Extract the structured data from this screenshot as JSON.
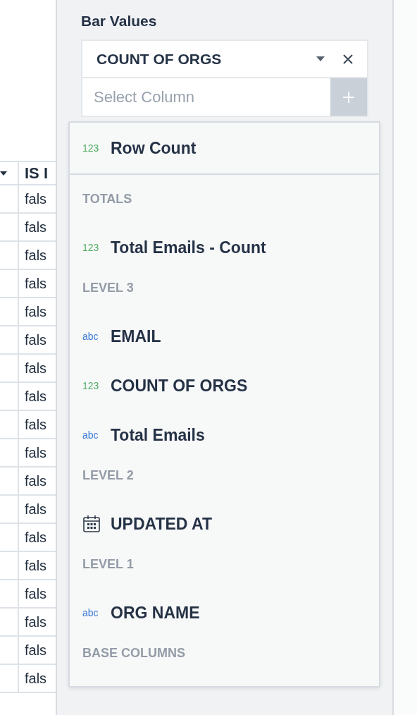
{
  "table": {
    "column_heading": "IS I",
    "rows": [
      "fals",
      "fals",
      "fals",
      "fals",
      "fals",
      "fals",
      "fals",
      "fals",
      "fals",
      "fals",
      "fals",
      "fals",
      "fals",
      "fals",
      "fals",
      "fals",
      "fals",
      "fals"
    ]
  },
  "panel": {
    "section_label": "Bar Values",
    "selected_value": "COUNT OF ORGS",
    "add_field": {
      "placeholder": "Select Column"
    }
  },
  "dropdown": {
    "top_item": {
      "type_label": "123",
      "color": "#4fae62",
      "label": "Row Count"
    },
    "items": [
      {
        "kind": "header",
        "label": "TOTALS"
      },
      {
        "kind": "item",
        "type_label": "123",
        "color": "#4fae62",
        "label": "Total Emails - Count"
      },
      {
        "kind": "header",
        "label": "LEVEL 3"
      },
      {
        "kind": "item",
        "type_label": "abc",
        "color": "#3a7bd5",
        "label": "EMAIL"
      },
      {
        "kind": "item",
        "type_label": "123",
        "color": "#4fae62",
        "label": "COUNT OF ORGS"
      },
      {
        "kind": "item",
        "type_label": "abc",
        "color": "#3a7bd5",
        "label": "Total Emails"
      },
      {
        "kind": "header",
        "label": "LEVEL 2"
      },
      {
        "kind": "date_item",
        "label": "UPDATED AT"
      },
      {
        "kind": "header",
        "label": "LEVEL 1"
      },
      {
        "kind": "item",
        "type_label": "abc",
        "color": "#3a7bd5",
        "label": "ORG NAME"
      },
      {
        "kind": "header",
        "label": "BASE COLUMNS"
      }
    ]
  }
}
